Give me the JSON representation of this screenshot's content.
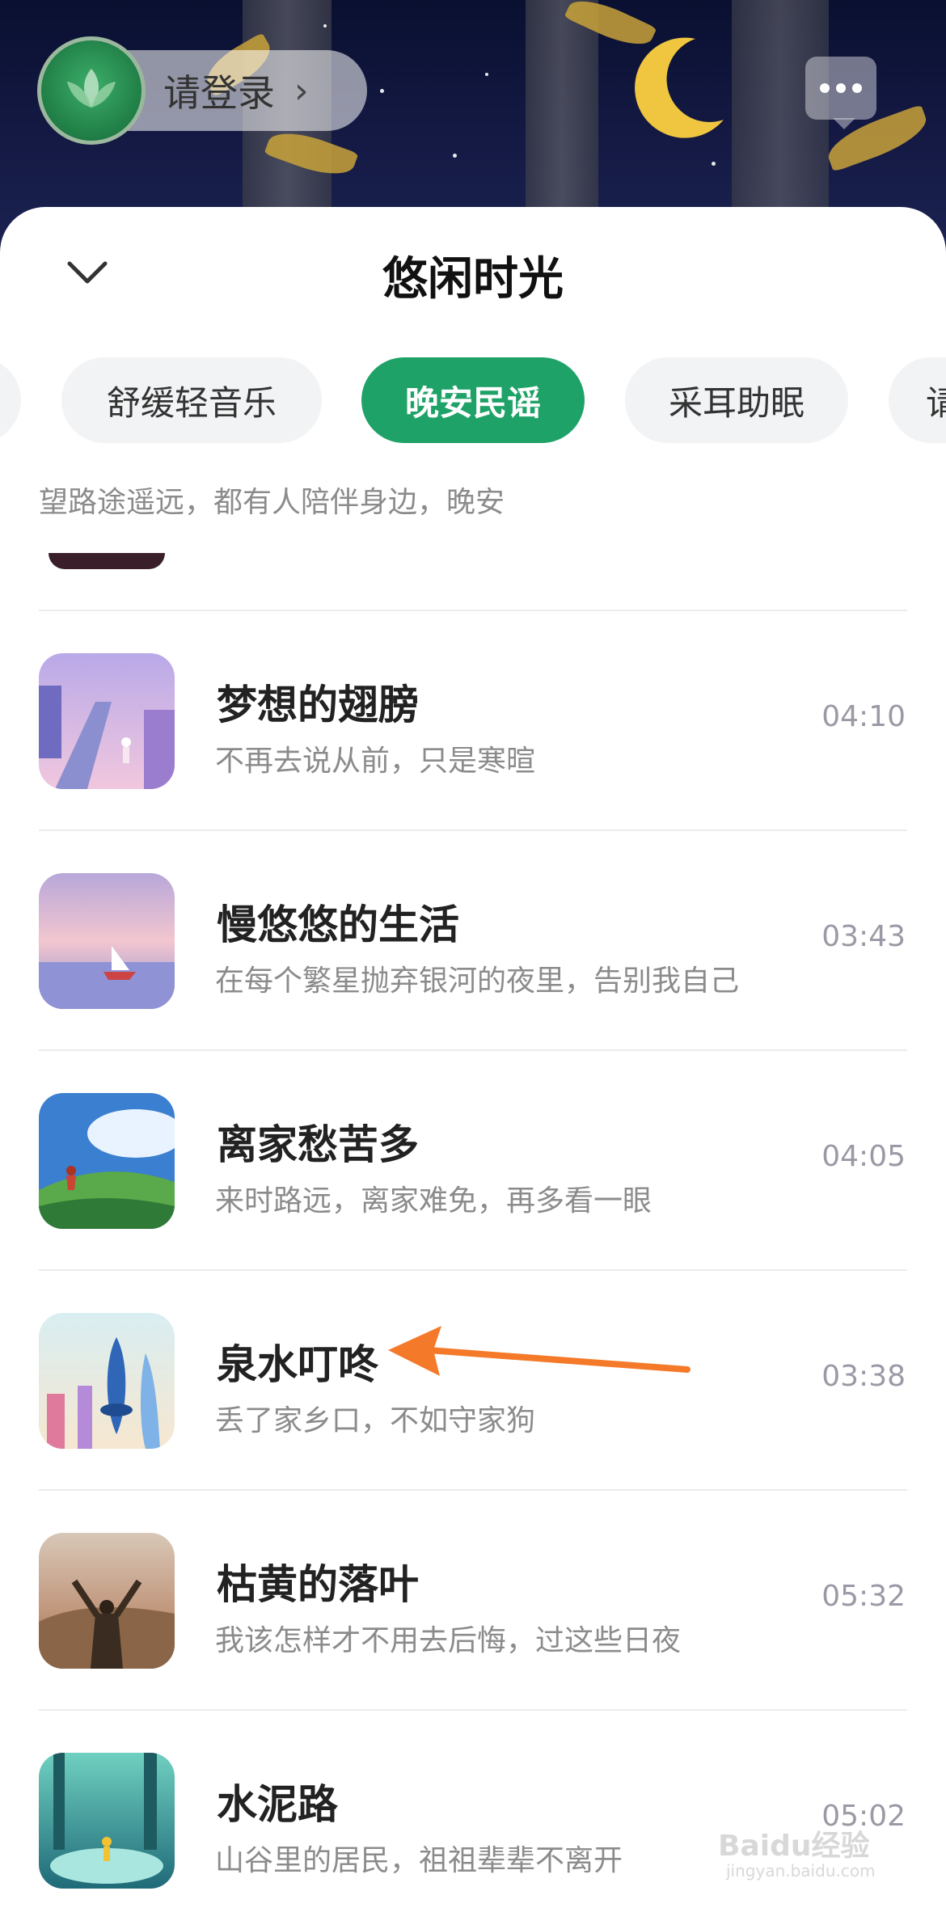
{
  "header": {
    "login_label": "请登录",
    "login_chevron": "›"
  },
  "sheet": {
    "title": "悠闲时光",
    "tabs": [
      {
        "label": "",
        "active": false
      },
      {
        "label": "舒缓轻音乐",
        "active": false
      },
      {
        "label": "晚安民谣",
        "active": true
      },
      {
        "label": "采耳助眠",
        "active": false
      },
      {
        "label": "请",
        "active": false
      }
    ],
    "subtitle": "望路途遥远，都有人陪伴身边，晚安",
    "songs": [
      {
        "title": "梦想的翅膀",
        "subtitle": "不再去说从前，只是寒暄",
        "duration": "04:10"
      },
      {
        "title": "慢悠悠的生活",
        "subtitle": "在每个繁星抛弃银河的夜里，告别我自己",
        "duration": "03:43"
      },
      {
        "title": "离家愁苦多",
        "subtitle": "来时路远，离家难免，再多看一眼",
        "duration": "04:05"
      },
      {
        "title": "泉水叮咚",
        "subtitle": "丢了家乡口，不如守家狗",
        "duration": "03:38"
      },
      {
        "title": "枯黄的落叶",
        "subtitle": "我该怎样才不用去后悔，过这些日夜",
        "duration": "05:32"
      },
      {
        "title": "水泥路",
        "subtitle": "山谷里的居民，祖祖辈辈不离开",
        "duration": "05:02"
      }
    ]
  },
  "watermark": {
    "text": "Baidu经验",
    "sub": "jingyan.baidu.com"
  },
  "colors": {
    "accent": "#1fa268",
    "annotation_arrow": "#f47a2a"
  },
  "icons": [
    "lotus-icon",
    "chevron-right-icon",
    "chat-icon",
    "chevron-down-icon",
    "annotation-arrow"
  ]
}
